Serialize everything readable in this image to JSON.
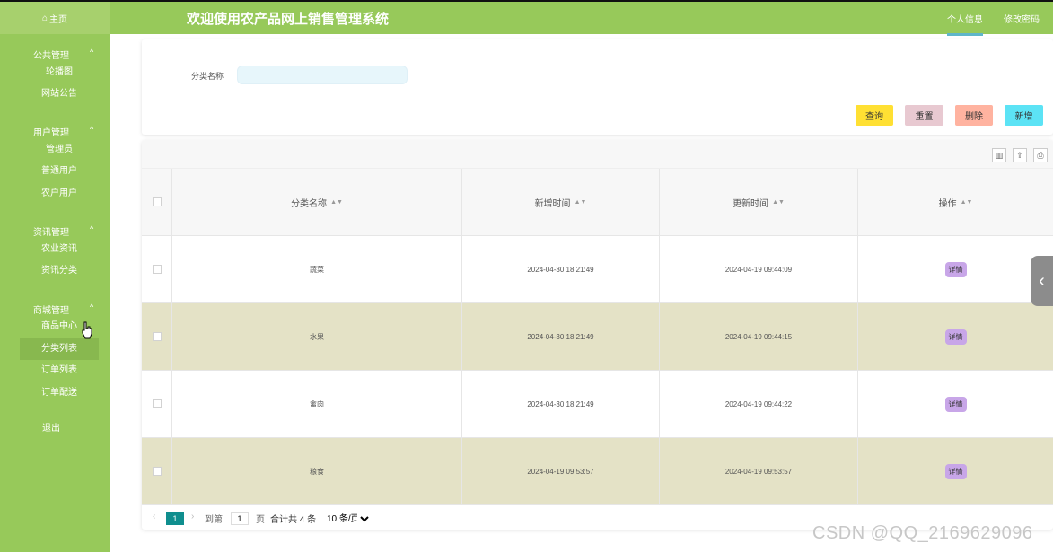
{
  "header": {
    "home_label": "主页",
    "app_title": "欢迎使用农产品网上销售管理系统",
    "links": [
      "个人信息",
      "修改密码"
    ]
  },
  "sidebar": {
    "groups": [
      {
        "title": "公共管理",
        "items": [
          "轮播图",
          "网站公告"
        ]
      },
      {
        "title": "用户管理",
        "items": [
          "管理员",
          "普通用户",
          "农户用户"
        ]
      },
      {
        "title": "资讯管理",
        "items": [
          "农业资讯",
          "资讯分类"
        ]
      },
      {
        "title": "商城管理",
        "items": [
          "商品中心",
          "分类列表",
          "订单列表",
          "订单配送"
        ]
      }
    ],
    "logout_label": "退出",
    "active_item": "分类列表"
  },
  "search": {
    "label": "分类名称",
    "placeholder": "",
    "value": ""
  },
  "actions": {
    "query": "查询",
    "reset": "重置",
    "delete": "删除",
    "add": "新增"
  },
  "colors": {
    "green": "#97c95a",
    "query": "#ffe033",
    "reset": "#e8c9d1",
    "delete": "#ffb3a0",
    "add": "#5ce3f5",
    "alt_row": "#e4e2c6",
    "detail": "#c8a6e8"
  },
  "table": {
    "columns": [
      "分类名称",
      "新增时间",
      "更新时间",
      "操作"
    ],
    "rows": [
      {
        "name": "蔬菜",
        "created": "2024-04-30 18:21:49",
        "updated": "2024-04-19 09:44:09",
        "action": "详情"
      },
      {
        "name": "水果",
        "created": "2024-04-30 18:21:49",
        "updated": "2024-04-19 09:44:15",
        "action": "详情"
      },
      {
        "name": "禽肉",
        "created": "2024-04-30 18:21:49",
        "updated": "2024-04-19 09:44:22",
        "action": "详情"
      },
      {
        "name": "粮食",
        "created": "2024-04-19 09:53:57",
        "updated": "2024-04-19 09:53:57",
        "action": "详情"
      }
    ]
  },
  "pager": {
    "current": "1",
    "goto_prefix": "到第",
    "goto_value": "1",
    "goto_suffix": "页",
    "total": "合计共 4 条",
    "page_size": "10 条/页"
  },
  "watermark": "CSDN @QQ_2169629096"
}
